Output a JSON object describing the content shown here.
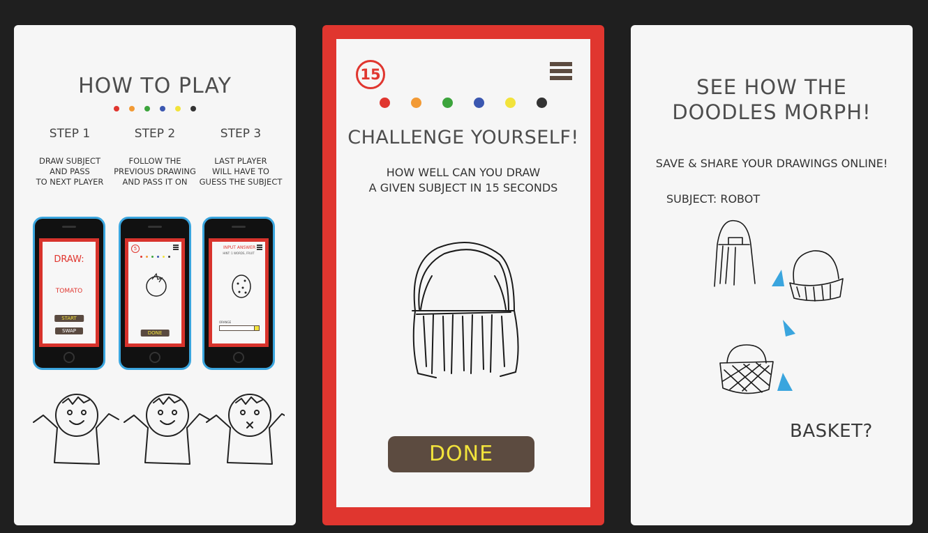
{
  "colors": {
    "background": "#1f1f1f",
    "panel": "#f6f6f6",
    "accent_red": "#e0362f",
    "button_brown": "#5c4b40",
    "button_text_yellow": "#f2e33b",
    "phone_frame_blue": "#3aa5de",
    "arrow_blue": "#3aa5de"
  },
  "dot_colors": [
    "#e0362f",
    "#f29a35",
    "#3ca43c",
    "#3b57b0",
    "#f2e33b",
    "#333333"
  ],
  "panel1": {
    "title": "HOW TO PLAY",
    "steps": [
      {
        "heading": "STEP 1",
        "lines": [
          "DRAW SUBJECT",
          "AND PASS",
          "TO NEXT PLAYER"
        ]
      },
      {
        "heading": "STEP 2",
        "lines": [
          "FOLLOW THE",
          "PREVIOUS DRAWING",
          "AND PASS IT ON"
        ]
      },
      {
        "heading": "STEP 3",
        "lines": [
          "LAST PLAYER",
          "WILL HAVE TO",
          "GUESS THE SUBJECT"
        ]
      }
    ],
    "phone1": {
      "draw_label": "DRAW:",
      "subject": "TOMATO",
      "start_label": "START",
      "swap_label": "SWAP"
    },
    "phone2": {
      "timer": "5",
      "done_label": "DONE"
    },
    "phone3": {
      "input_label": "INPUT ANSWER",
      "hint": "HINT: 1 WORDS, FRUIT",
      "answer_value": "ORANGE"
    }
  },
  "panel2": {
    "timer": "15",
    "title": "CHALLENGE YOURSELF!",
    "line1": "HOW WELL CAN YOU DRAW",
    "line2": "A GIVEN SUBJECT IN 15 SECONDS",
    "done_label": "DONE"
  },
  "panel3": {
    "title_line1": "SEE HOW THE",
    "title_line2": "DOODLES MORPH!",
    "subtitle": "SAVE & SHARE YOUR DRAWINGS ONLINE!",
    "subject": "SUBJECT: ROBOT",
    "guess": "BASKET?"
  }
}
